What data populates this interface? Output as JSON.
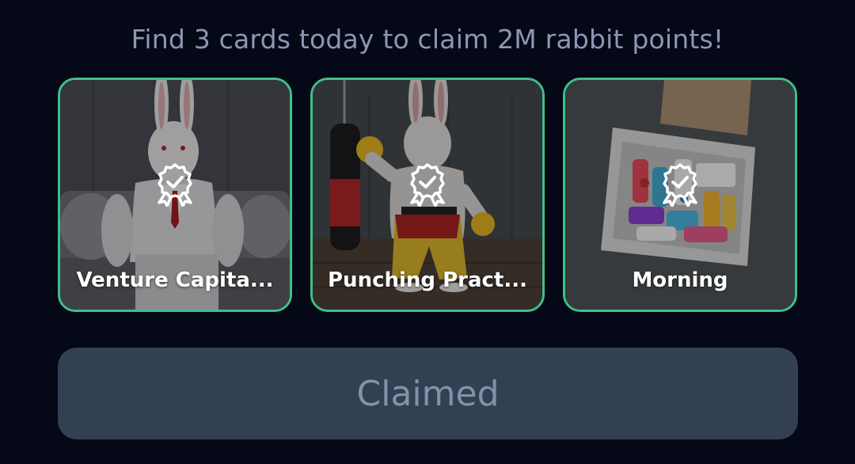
{
  "header": {
    "text": "Find 3 cards today to claim 2M rabbit points!"
  },
  "cards": [
    {
      "title": "Venture Capita...",
      "status_icon": "award-check-icon",
      "image": "rabbit-in-suit-on-couch"
    },
    {
      "title": "Punching Pract...",
      "status_icon": "award-check-icon",
      "image": "muscular-rabbit-boxing"
    },
    {
      "title": "Morning",
      "status_icon": "award-check-icon",
      "image": "box-of-pill-bottles"
    }
  ],
  "claim_button": {
    "label": "Claimed"
  },
  "colors": {
    "background": "#050816",
    "card_border": "#3fbf88",
    "button_bg": "#334052",
    "button_text": "#8391aa",
    "headline": "#8d97b3"
  }
}
